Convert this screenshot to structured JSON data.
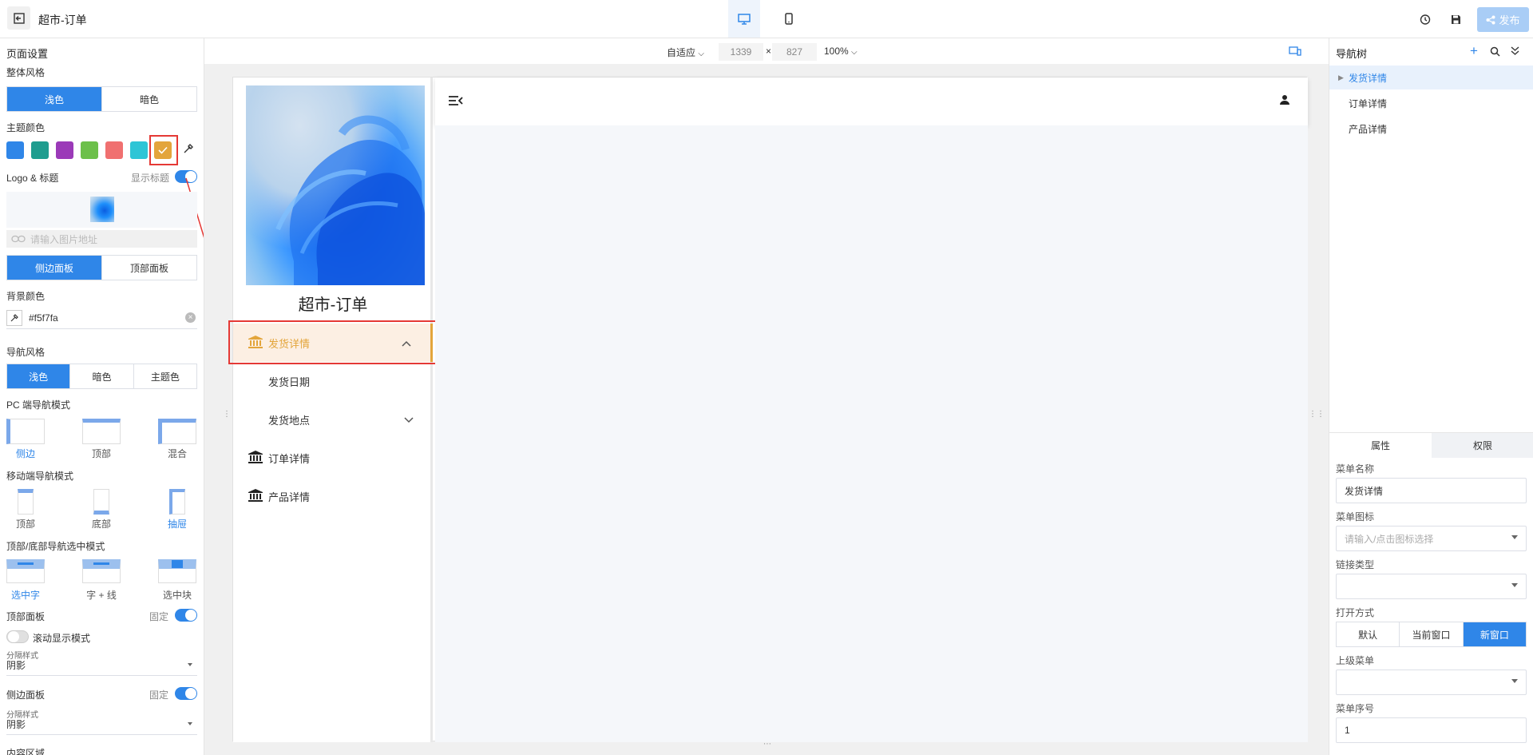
{
  "topbar": {
    "title": "超市-订单",
    "publish_label": "发布",
    "icons": [
      "exit-icon",
      "desktop-icon",
      "mobile-icon",
      "history-icon",
      "save-icon",
      "share-icon"
    ]
  },
  "left": {
    "page_settings": "页面设置",
    "overall_style": "整体风格",
    "style_light": "浅色",
    "style_dark": "暗色",
    "theme_color": "主题颜色",
    "swatches": [
      "#2f86e8",
      "#1f9d8f",
      "#9b3ab8",
      "#6cc04a",
      "#f07070",
      "#2ec5d6",
      "#e3a53b"
    ],
    "logo_title": "Logo & 标题",
    "show_title": "显示标题",
    "image_placeholder": "请输入图片地址",
    "side_panel": "侧边面板",
    "top_panel": "顶部面板",
    "bg_color": "背景颜色",
    "bg_value": "#f5f7fa",
    "nav_style": "导航风格",
    "nav_light": "浅色",
    "nav_dark": "暗色",
    "nav_theme": "主题色",
    "pc_nav_mode": "PC 端导航模式",
    "pc_opts": [
      "侧边",
      "顶部",
      "混合"
    ],
    "mobile_nav_mode": "移动端导航模式",
    "mobile_opts": [
      "顶部",
      "底部",
      "抽屉"
    ],
    "select_mode": "顶部/底部导航选中模式",
    "select_opts": [
      "选中字",
      "字 + 线",
      "选中块"
    ],
    "top_panel_label": "顶部面板",
    "fixed": "固定",
    "scroll_mode": "滚动显示模式",
    "divider_style": "分隔样式",
    "shadow": "阴影",
    "side_panel_label": "侧边面板",
    "content_area": "内容区域"
  },
  "canvas": {
    "fit": "自适应",
    "width": "1339",
    "times": "×",
    "height": "827",
    "zoom": "100%"
  },
  "preview": {
    "site_title": "超市-订单",
    "menu": [
      {
        "label": "发货详情",
        "active": true
      },
      {
        "label": "发货日期"
      },
      {
        "label": "发货地点"
      },
      {
        "label": "订单详情"
      },
      {
        "label": "产品详情"
      }
    ]
  },
  "right": {
    "nav_tree": "导航树",
    "tree": [
      "发货详情",
      "订单详情",
      "产品详情"
    ],
    "tab_props": "属性",
    "tab_perm": "权限",
    "menu_name_label": "菜单名称",
    "menu_name_value": "发货详情",
    "menu_icon_label": "菜单图标",
    "menu_icon_placeholder": "请输入/点击图标选择",
    "link_type_label": "链接类型",
    "open_mode_label": "打开方式",
    "open_opts": [
      "默认",
      "当前窗口",
      "新窗口"
    ],
    "parent_menu_label": "上级菜单",
    "menu_order_label": "菜单序号",
    "menu_order_value": "1"
  }
}
